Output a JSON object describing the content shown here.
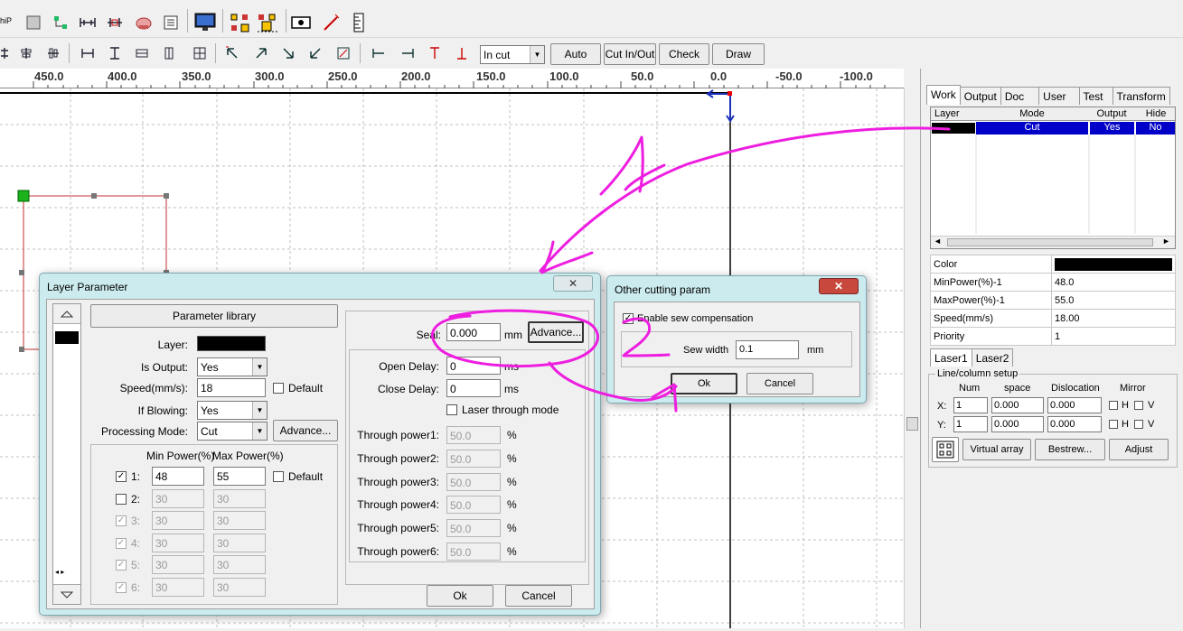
{
  "toolbar1": {
    "first_label": "hiP",
    "icons": [
      "select-icon",
      "node-edit-icon",
      "align-h-icon",
      "align-v-icon",
      "laser-head-icon",
      "data-list-icon",
      "monitor-icon",
      "array-icon",
      "array2-icon",
      "camera-icon",
      "wand-icon",
      "ruler-icon"
    ]
  },
  "toolbar2": {
    "cut_mode": "In cut",
    "auto_label": "Auto",
    "cutinout_label": "Cut In/Out",
    "check_label": "Check",
    "draw_label": "Draw"
  },
  "ruler": {
    "labels": [
      "450.0",
      "400.0",
      "350.0",
      "300.0",
      "250.0",
      "200.0",
      "150.0",
      "100.0",
      "50.0",
      "0.0",
      "-50.0",
      "-100.0"
    ]
  },
  "right_panel": {
    "tabs": [
      "Work",
      "Output",
      "Doc",
      "User",
      "Test",
      "Transform"
    ],
    "active_tab": "Work",
    "layer_table": {
      "headers": [
        "Layer",
        "Mode",
        "Output",
        "Hide"
      ],
      "row": {
        "layer_color": "#000000",
        "mode": "Cut",
        "output": "Yes",
        "hide": "No"
      }
    },
    "properties": [
      {
        "name": "Color",
        "value": ""
      },
      {
        "name": "MinPower(%)-1",
        "value": "48.0"
      },
      {
        "name": "MaxPower(%)-1",
        "value": "55.0"
      },
      {
        "name": "Speed(mm/s)",
        "value": "18.00"
      },
      {
        "name": "Priority",
        "value": "1"
      }
    ],
    "laser_tabs": [
      "Laser1",
      "Laser2"
    ],
    "line_setup": {
      "title": "Line/column setup",
      "headers": [
        "Num",
        "space",
        "Dislocation",
        "Mirror"
      ],
      "x": {
        "label": "X:",
        "num": "1",
        "space": "0.000",
        "dislocation": "0.000"
      },
      "y": {
        "label": "Y:",
        "num": "1",
        "space": "0.000",
        "dislocation": "0.000"
      },
      "mirror_h": "H",
      "mirror_v": "V"
    },
    "virtual_array_label": "Virtual array",
    "bestrew_label": "Bestrew...",
    "adjust_label": "Adjust"
  },
  "layer_dialog": {
    "title": "Layer Parameter",
    "close": "✕",
    "param_library": "Parameter library",
    "layer_label": "Layer:",
    "layer_color": "#000000",
    "is_output_label": "Is Output:",
    "is_output": "Yes",
    "speed_label": "Speed(mm/s):",
    "speed": "18",
    "default_label": "Default",
    "if_blowing_label": "If Blowing:",
    "if_blowing": "Yes",
    "processing_mode_label": "Processing Mode:",
    "processing_mode": "Cut",
    "advance_label": "Advance...",
    "min_power_hdr": "Min Power(%)",
    "max_power_hdr": "Max Power(%)",
    "power_rows": [
      {
        "label": "1:",
        "checked": true,
        "enabled": true,
        "min": "48",
        "max": "55"
      },
      {
        "label": "2:",
        "checked": false,
        "enabled": true,
        "min": "30",
        "max": "30"
      },
      {
        "label": "3:",
        "checked": true,
        "enabled": false,
        "min": "30",
        "max": "30"
      },
      {
        "label": "4:",
        "checked": true,
        "enabled": false,
        "min": "30",
        "max": "30"
      },
      {
        "label": "5:",
        "checked": true,
        "enabled": false,
        "min": "30",
        "max": "30"
      },
      {
        "label": "6:",
        "checked": true,
        "enabled": false,
        "min": "30",
        "max": "30"
      }
    ],
    "power_default_label": "Default",
    "seal_label": "Seal:",
    "seal": "0.000",
    "mm": "mm",
    "ms": "ms",
    "pct": "%",
    "seal_advance_label": "Advance...",
    "open_delay_label": "Open Delay:",
    "open_delay": "0",
    "close_delay_label": "Close Delay:",
    "close_delay": "0",
    "laser_through_label": "Laser through mode",
    "through_powers": [
      {
        "label": "Through power1:",
        "value": "50.0"
      },
      {
        "label": "Through power2:",
        "value": "50.0"
      },
      {
        "label": "Through power3:",
        "value": "50.0"
      },
      {
        "label": "Through power4:",
        "value": "50.0"
      },
      {
        "label": "Through power5:",
        "value": "50.0"
      },
      {
        "label": "Through power6:",
        "value": "50.0"
      }
    ],
    "ok_label": "Ok",
    "cancel_label": "Cancel"
  },
  "other_dialog": {
    "title": "Other cutting param",
    "close": "✕",
    "enable_sew_label": "Enable sew compensation",
    "sew_width_label": "Sew width",
    "sew_width": "0.1",
    "mm": "mm",
    "ok_label": "Ok",
    "cancel_label": "Cancel"
  },
  "annotations": {
    "one": "1",
    "two": "2"
  }
}
